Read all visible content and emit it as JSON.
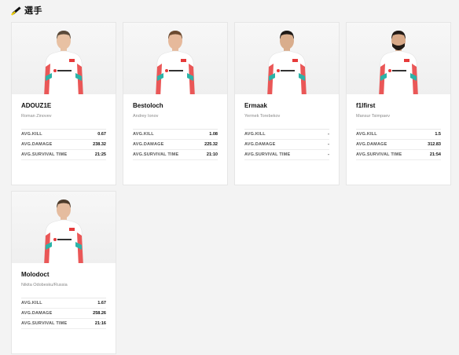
{
  "section": {
    "title": "選手"
  },
  "players": [
    {
      "name": "ADOUZ1E",
      "real_name": "Roman Zinovev",
      "stats": [
        {
          "label": "AVG.KILL",
          "value": "0.67"
        },
        {
          "label": "AVG.DAMAGE",
          "value": "238.32"
        },
        {
          "label": "AVG.SURVIVAL TIME",
          "value": "21:25"
        }
      ],
      "hair": "#5a4a3a",
      "skin": "#e8c1a3",
      "beard": false
    },
    {
      "name": "Bestoloch",
      "real_name": "Andrey Ionov",
      "stats": [
        {
          "label": "AVG.KILL",
          "value": "1.08"
        },
        {
          "label": "AVG.DAMAGE",
          "value": "225.32"
        },
        {
          "label": "AVG.SURVIVAL TIME",
          "value": "21:10"
        }
      ],
      "hair": "#6b4a30",
      "skin": "#e6b99b",
      "beard": false
    },
    {
      "name": "Ermaak",
      "real_name": "Yermek Torebekov",
      "stats": [
        {
          "label": "AVG.KILL",
          "value": "-"
        },
        {
          "label": "AVG.DAMAGE",
          "value": "-"
        },
        {
          "label": "AVG.SURVIVAL TIME",
          "value": "-"
        }
      ],
      "hair": "#1f1a17",
      "skin": "#d9ad8c",
      "beard": false
    },
    {
      "name": "f1lfirst",
      "real_name": "Mansur Tsimpaev",
      "stats": [
        {
          "label": "AVG.KILL",
          "value": "1.5"
        },
        {
          "label": "AVG.DAMAGE",
          "value": "312.83"
        },
        {
          "label": "AVG.SURVIVAL TIME",
          "value": "21:54"
        }
      ],
      "hair": "#231b16",
      "skin": "#d8a988",
      "beard": true
    },
    {
      "name": "Molodoct",
      "real_name": "Nikita Odobesku/Russia",
      "stats": [
        {
          "label": "AVG.KILL",
          "value": "1.67"
        },
        {
          "label": "AVG.DAMAGE",
          "value": "258.26"
        },
        {
          "label": "AVG.SURVIVAL TIME",
          "value": "21:16"
        }
      ],
      "hair": "#4e3c2c",
      "skin": "#e5bc9f",
      "beard": false
    }
  ],
  "colors": {
    "accent_yellow": "#f2d200",
    "jersey_red": "#e63a3a",
    "jersey_teal": "#2bb3a8"
  }
}
